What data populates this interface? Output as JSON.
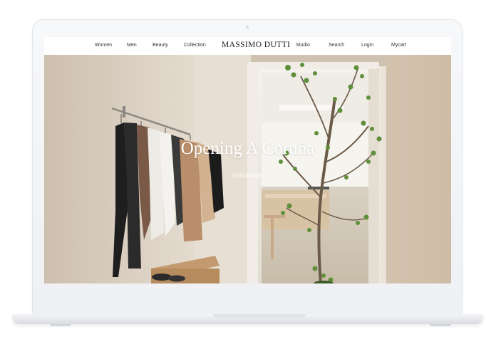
{
  "nav": {
    "items_left": [
      "Women",
      "Men",
      "Beauty",
      "Collection"
    ],
    "brand": "MASSIMO DUTTI",
    "items_right": [
      "Studio",
      "Search",
      "Login",
      "Mycart"
    ]
  },
  "hero": {
    "title": "Opening A Coruña",
    "cta": "READ & MORE"
  },
  "colors": {
    "nav_text": "#333333",
    "brand_text": "#1a1a1a",
    "hero_text": "#ffffff",
    "laptop_frame": "#f2f3f5"
  }
}
